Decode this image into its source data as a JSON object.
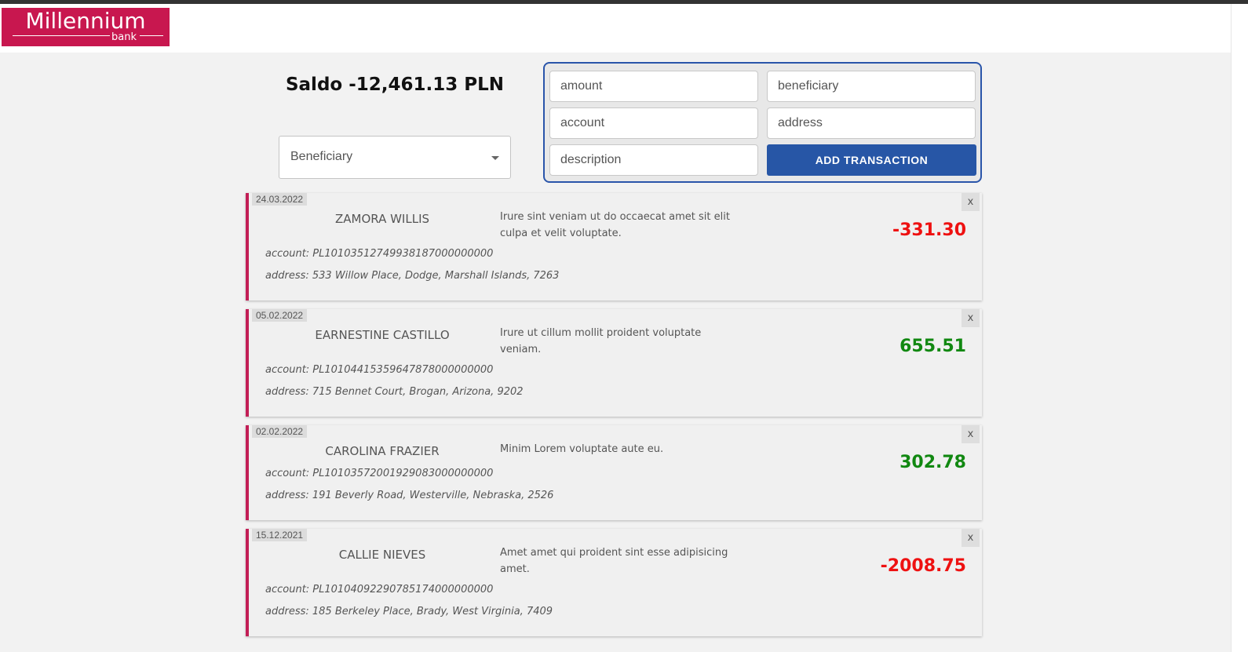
{
  "header": {
    "logo_main": "Millennium",
    "logo_sub": "bank"
  },
  "saldo": "Saldo -12,461.13 PLN",
  "filter": {
    "selected": "Beneficiary"
  },
  "form": {
    "amount_placeholder": "amount",
    "beneficiary_placeholder": "beneficiary",
    "account_placeholder": "account",
    "address_placeholder": "address",
    "description_placeholder": "description",
    "submit_label": "ADD TRANSACTION"
  },
  "transactions": [
    {
      "date": "24.03.2022",
      "name": "ZAMORA WILLIS",
      "description": "Irure sint veniam ut do occaecat amet sit elit culpa et velit voluptate.",
      "account": "account: PL10103512749938187000000000",
      "address": "address: 533 Willow Place, Dodge, Marshall Islands, 7263",
      "amount": "-331.30",
      "close": "x"
    },
    {
      "date": "05.02.2022",
      "name": "EARNESTINE CASTILLO",
      "description": "Irure ut cillum mollit proident voluptate veniam.",
      "account": "account: PL10104415359647878000000000",
      "address": "address: 715 Bennet Court, Brogan, Arizona, 9202",
      "amount": "655.51",
      "close": "x"
    },
    {
      "date": "02.02.2022",
      "name": "CAROLINA FRAZIER",
      "description": "Minim Lorem voluptate aute eu.",
      "account": "account: PL10103572001929083000000000",
      "address": "address: 191 Beverly Road, Westerville, Nebraska, 2526",
      "amount": "302.78",
      "close": "x"
    },
    {
      "date": "15.12.2021",
      "name": "CALLIE NIEVES",
      "description": "Amet amet qui proident sint esse adipisicing amet.",
      "account": "account: PL10104092290785174000000000",
      "address": "address: 185 Berkeley Place, Brady, West Virginia, 7409",
      "amount": "-2008.75",
      "close": "x"
    }
  ]
}
